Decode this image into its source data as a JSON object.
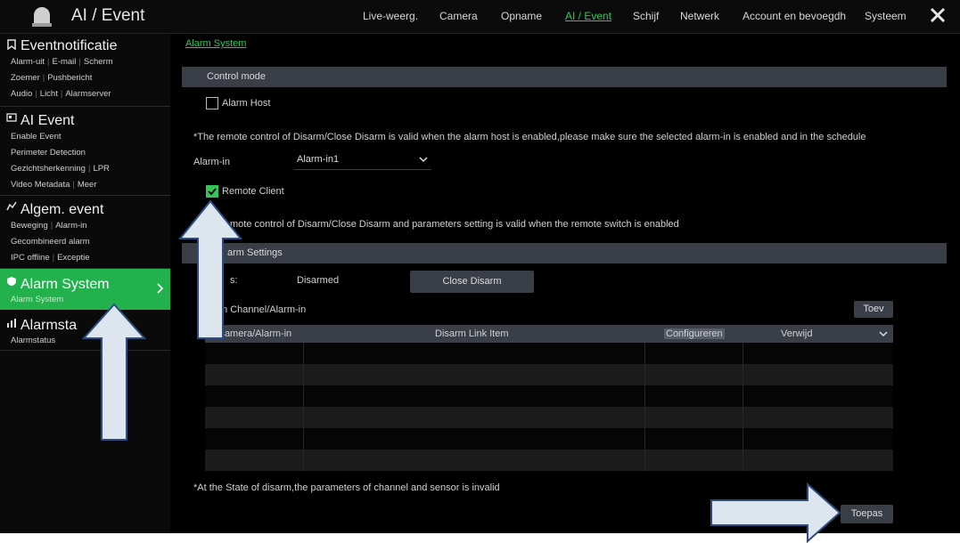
{
  "header": {
    "title": "AI / Event",
    "nav": [
      "Live-weerg.",
      "Camera",
      "Opname",
      "AI / Event",
      "Schijf",
      "Netwerk",
      "Account en bevoegdh",
      "Systeem"
    ],
    "active_nav": "AI / Event"
  },
  "sidebar": {
    "sections": [
      {
        "title": "Eventnotificatie",
        "lines": [
          [
            "Alarm-uit",
            "E-mail",
            "Scherm"
          ],
          [
            "Zoemer",
            "Pushbericht"
          ],
          [
            "Audio",
            "Licht",
            "Alarmserver"
          ]
        ]
      },
      {
        "title": "AI Event",
        "lines": [
          [
            "Enable Event"
          ],
          [
            "Perimeter Detection"
          ],
          [
            "Gezichtsherkenning",
            "LPR"
          ],
          [
            "Video Metadata",
            "Meer"
          ]
        ]
      },
      {
        "title": "Algem. event",
        "lines": [
          [
            "Beweging",
            "Alarm-in"
          ],
          [
            "Gecombineerd alarm"
          ],
          [
            "IPC offline",
            "Exceptie"
          ]
        ]
      },
      {
        "title": "Alarm System",
        "lines": [
          [
            "Alarm System"
          ]
        ],
        "selected": true
      },
      {
        "title": "Alarmsta",
        "lines": [
          [
            "Alarmstatus"
          ]
        ]
      }
    ]
  },
  "main": {
    "breadcrumb": "Alarm System",
    "control_mode": {
      "band_label": "Control mode",
      "alarm_host_label": "Alarm Host",
      "alarm_host_checked": false,
      "host_note": "*The remote control of Disarm/Close Disarm is valid when the alarm host is enabled,please make sure the selected alarm-in is enabled and in the schedule",
      "alarm_in_label": "Alarm-in",
      "alarm_in_value": "Alarm-in1",
      "remote_client_label": "Remote Client",
      "remote_client_checked": true,
      "remote_note": "mote control of Disarm/Close Disarm and parameters setting is valid when the remote switch is enabled"
    },
    "disarm_settings": {
      "band_label": "arm Settings",
      "status_label": "s:",
      "status_value": "Disarmed",
      "close_disarm_button": "Close Disarm",
      "channel_label": "m Channel/Alarm-in",
      "add_button": "Toev",
      "table": {
        "columns": [
          "Camera/Alarm-in",
          "Disarm Link Item",
          "Configureren",
          "Verwijd"
        ],
        "rows": [
          [],
          [],
          [],
          [],
          [],
          []
        ]
      },
      "footnote": "*At the State of disarm,the parameters of channel and sensor is invalid",
      "apply_button": "Toepas"
    }
  },
  "colors": {
    "accent_green": "#22b14c",
    "link_green": "#33c55a",
    "band_gray": "#3a3f47",
    "arrow_fill": "#dde5ee",
    "arrow_stroke": "#2c4d82"
  },
  "icons": [
    "app-logo-icon",
    "pin-icon",
    "ai-event-icon",
    "general-event-icon",
    "shield-icon",
    "alarm-status-icon",
    "close-icon",
    "chevron-right-icon",
    "chevron-down-icon",
    "check-icon"
  ]
}
